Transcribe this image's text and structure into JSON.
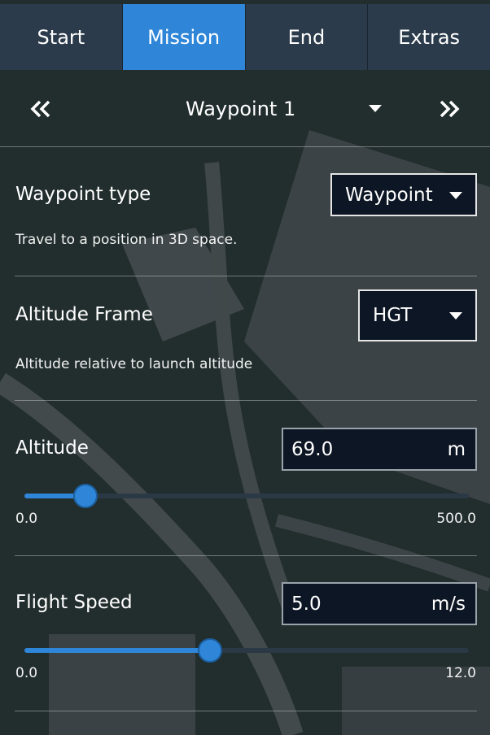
{
  "tabs": [
    {
      "label": "Start",
      "active": false
    },
    {
      "label": "Mission",
      "active": true
    },
    {
      "label": "End",
      "active": false
    },
    {
      "label": "Extras",
      "active": false
    }
  ],
  "waypoint_nav": {
    "title": "Waypoint 1",
    "prev_icon": "double-chevron-left-icon",
    "next_icon": "double-chevron-right-icon",
    "dropdown_icon": "caret-down-icon"
  },
  "waypoint_type": {
    "label": "Waypoint type",
    "value": "Waypoint",
    "description": "Travel to a position in 3D space."
  },
  "altitude_frame": {
    "label": "Altitude Frame",
    "value": "HGT",
    "description": "Altitude relative to launch altitude"
  },
  "altitude": {
    "label": "Altitude",
    "value": "69.0",
    "unit": "m",
    "min": "0.0",
    "max": "500.0",
    "level": 0.138
  },
  "flight_speed": {
    "label": "Flight Speed",
    "value": "5.0",
    "unit": "m/s",
    "min": "0.0",
    "max": "12.0",
    "level": 0.417
  },
  "colors": {
    "accent": "#2f86d8",
    "tab_bg": "#2c3b4b",
    "field_bg": "#0d1624"
  }
}
